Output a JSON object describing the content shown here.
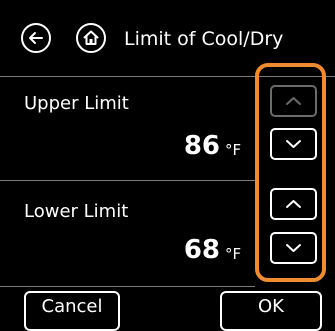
{
  "header": {
    "title": "Limit of Cool/Dry",
    "back_icon": "back-arrow-icon",
    "home_icon": "home-icon"
  },
  "upper": {
    "label": "Upper Limit",
    "value": "86",
    "unit": "°F",
    "up_enabled": false,
    "down_enabled": true
  },
  "lower": {
    "label": "Lower Limit",
    "value": "68",
    "unit": "°F",
    "up_enabled": true,
    "down_enabled": true
  },
  "buttons": {
    "cancel": "Cancel",
    "ok": "OK"
  },
  "colors": {
    "background": "#000000",
    "text": "#ffffff",
    "highlight": "#f08c30",
    "disabled": "#6b6b6b",
    "divider": "#7a7a7a"
  }
}
